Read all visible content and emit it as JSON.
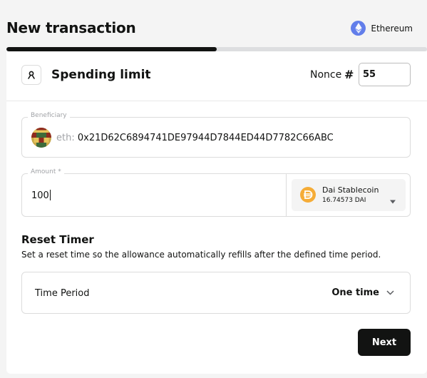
{
  "header": {
    "title": "New transaction"
  },
  "network": {
    "name": "Ethereum",
    "icon": "ethereum-icon",
    "color": "#627eea"
  },
  "progress": {
    "percent": 50
  },
  "spending_limit": {
    "title": "Spending limit",
    "icon": "spending-limit-icon",
    "nonce_label": "Nonce",
    "nonce_hash": "#",
    "nonce_value": "55"
  },
  "beneficiary": {
    "legend": "Beneficiary",
    "prefix": "eth:",
    "address": "0x21D62C6894741DE97944D7844ED44D7782C66ABC"
  },
  "amount": {
    "legend": "Amount *",
    "value": "100",
    "token_name": "Dai Stablecoin",
    "token_balance": "16.74573 DAI",
    "token_icon": "dai-icon",
    "token_color": "#f5ac37"
  },
  "reset_timer": {
    "title": "Reset Timer",
    "description": "Set a reset time so the allowance automatically refills after the defined time period.",
    "period_label": "Time Period",
    "period_value": "One time"
  },
  "actions": {
    "next_label": "Next"
  }
}
